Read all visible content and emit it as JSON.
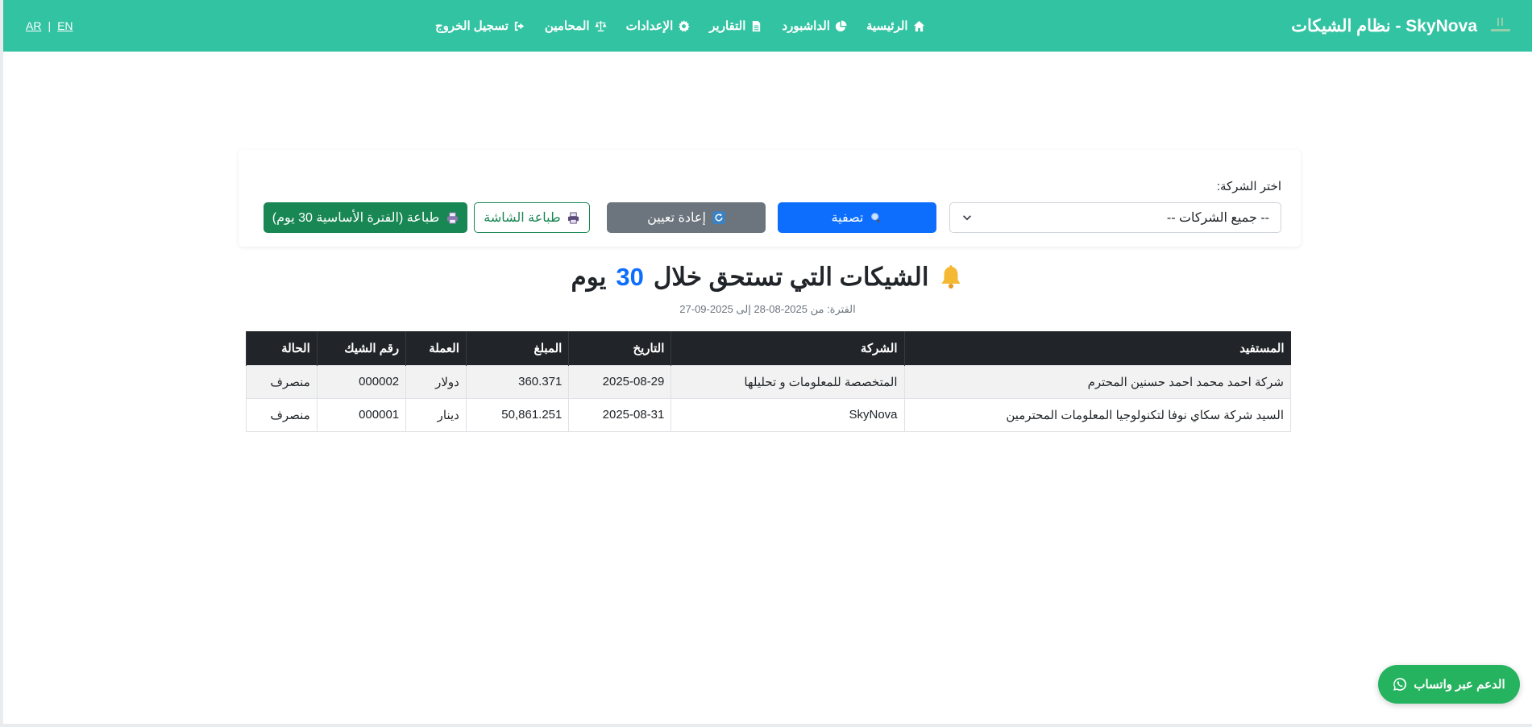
{
  "navbar": {
    "brand_title": "SkyNova - نظام الشيكات",
    "links": [
      {
        "label": "الرئيسية",
        "icon": "home-icon"
      },
      {
        "label": "الداشبورد",
        "icon": "pie-chart-icon"
      },
      {
        "label": "التقارير",
        "icon": "document-icon"
      },
      {
        "label": "الإعدادات",
        "icon": "gear-icon"
      },
      {
        "label": "المحامين",
        "icon": "scales-icon"
      },
      {
        "label": "تسجيل الخروج",
        "icon": "logout-icon"
      }
    ],
    "lang": {
      "ar": "AR",
      "sep": "|",
      "en": "EN"
    }
  },
  "filter": {
    "company_label": "اختر الشركة:",
    "company_selected": "-- جميع الشركات --",
    "filter_button": "تصفية",
    "reset_button": "إعادة تعيين",
    "print_screen_button": "طباعة الشاشة",
    "print_base_button": "طباعة (الفترة الأساسية 30 يوم)"
  },
  "heading": {
    "prefix": "الشيكات التي تستحق خلال",
    "days": "30",
    "suffix": "يوم",
    "period": "الفترة: من 2025-08-28 إلى 2025-09-27"
  },
  "table": {
    "headers": [
      "المستفيد",
      "الشركة",
      "التاريخ",
      "المبلغ",
      "العملة",
      "رقم الشيك",
      "الحالة"
    ],
    "rows": [
      [
        "شركة احمد محمد احمد حسنين المحترم",
        "المتخصصة للمعلومات و تحليلها",
        "2025-08-29",
        "360.371",
        "دولار",
        "000002",
        "منصرف"
      ],
      [
        "السيد شركة سكاي نوفا لتكنولوجيا المعلومات المحترمين",
        "SkyNova",
        "2025-08-31",
        "50,861.251",
        "دينار",
        "000001",
        "منصرف"
      ]
    ]
  },
  "support": {
    "label": "الدعم عبر واتساب"
  },
  "colors": {
    "navbar": "#32c3a2",
    "primary": "#0d6efd",
    "secondary": "#6c757d",
    "success": "#198754",
    "whatsapp": "#25b35f",
    "table_head": "#212529"
  }
}
